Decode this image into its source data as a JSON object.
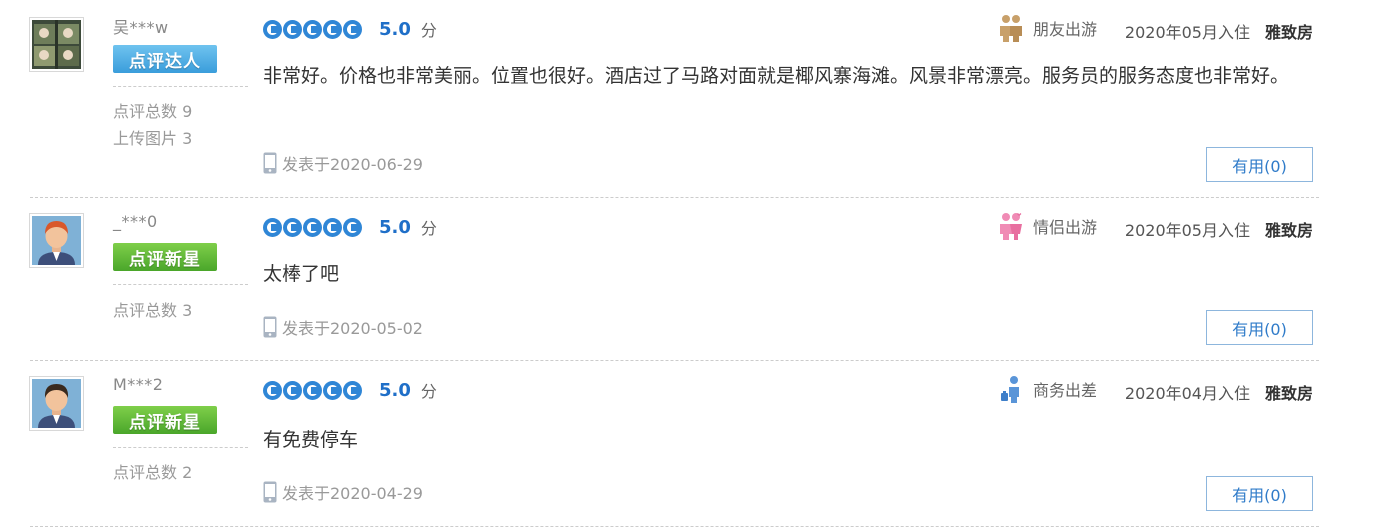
{
  "reviews": [
    {
      "username": "吴***w",
      "badge": "点评达人",
      "badge_color": "#3a9ddb",
      "stats": [
        "点评总数 9",
        "上传图片 3"
      ],
      "score": "5.0",
      "score_unit": "分",
      "rating_circles": 5,
      "trip_type": "朋友出游",
      "trip_icon": "friends-icon",
      "checkin": "2020年05月入住",
      "room": "雅致房",
      "content": "非常好。价格也非常美丽。位置也很好。酒店过了马路对面就是椰风寨海滩。风景非常漂亮。服务员的服务态度也非常好。",
      "posted": "发表于2020-06-29",
      "useful": "有用(0)"
    },
    {
      "username": "_***0",
      "badge": "点评新星",
      "badge_color": "#4aa62a",
      "stats": [
        "点评总数 3"
      ],
      "score": "5.0",
      "score_unit": "分",
      "rating_circles": 5,
      "trip_type": "情侣出游",
      "trip_icon": "couple-icon",
      "checkin": "2020年05月入住",
      "room": "雅致房",
      "content": "太棒了吧",
      "posted": "发表于2020-05-02",
      "useful": "有用(0)"
    },
    {
      "username": "M***2",
      "badge": "点评新星",
      "badge_color": "#4aa62a",
      "stats": [
        "点评总数 2"
      ],
      "score": "5.0",
      "score_unit": "分",
      "rating_circles": 5,
      "trip_type": "商务出差",
      "trip_icon": "business-trip-icon",
      "checkin": "2020年04月入住",
      "room": "雅致房",
      "content": "有免费停车",
      "posted": "发表于2020-04-29",
      "useful": "有用(0)"
    }
  ]
}
